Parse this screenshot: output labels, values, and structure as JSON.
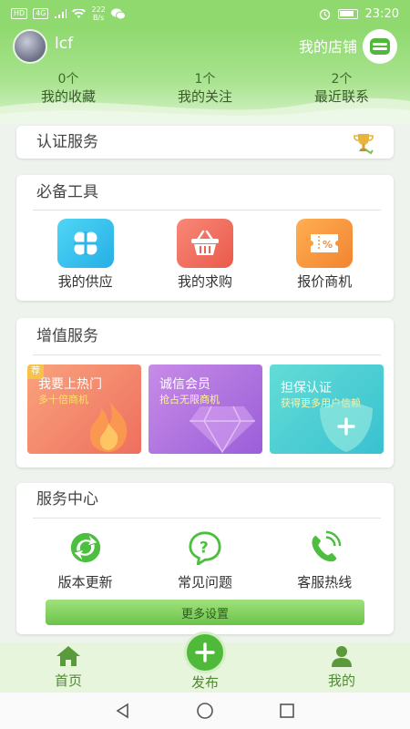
{
  "status_bar": {
    "net_tag_1": "HD",
    "net_tag_2": "4G",
    "net_speed_value": "222",
    "net_speed_unit": "B/s",
    "time": "23:20",
    "icons": [
      "signal-icon",
      "wifi-icon",
      "wechat-icon",
      "alarm-icon",
      "battery-icon"
    ]
  },
  "header": {
    "username": "lcf",
    "shop_label": "我的店铺",
    "shop_icon": "shop-icon",
    "stats": [
      {
        "count": "0个",
        "label": "我的收藏"
      },
      {
        "count": "1个",
        "label": "我的关注"
      },
      {
        "count": "2个",
        "label": "最近联系"
      }
    ]
  },
  "certification": {
    "title": "认证服务",
    "icon": "trophy-icon"
  },
  "tools": {
    "title": "必备工具",
    "items": [
      {
        "label": "我的供应",
        "icon": "clover-icon",
        "color": "#3dc7ef"
      },
      {
        "label": "我的求购",
        "icon": "basket-icon",
        "color": "#f26d5f"
      },
      {
        "label": "报价商机",
        "icon": "ticket-icon",
        "color": "#f7943a"
      }
    ]
  },
  "value_added": {
    "title": "增值服务",
    "promos": [
      {
        "badge": "荐",
        "title": "我要上热门",
        "subtitle": "多十倍商机",
        "icon": "flame-icon"
      },
      {
        "title": "诚信会员",
        "subtitle": "抢占无限商机",
        "icon": "diamond-icon"
      },
      {
        "title": "担保认证",
        "subtitle": "获得更多用户信赖",
        "icon": "shield-icon"
      }
    ]
  },
  "service_center": {
    "title": "服务中心",
    "items": [
      {
        "label": "版本更新",
        "icon": "refresh-icon"
      },
      {
        "label": "常见问题",
        "icon": "question-icon"
      },
      {
        "label": "客服热线",
        "icon": "phone-icon"
      }
    ],
    "more_button": "更多设置"
  },
  "tabbar": {
    "home": "首页",
    "post": "发布",
    "mine": "我的"
  },
  "colors": {
    "brand_green": "#8fd96f",
    "tab_green": "#4fb93a"
  }
}
